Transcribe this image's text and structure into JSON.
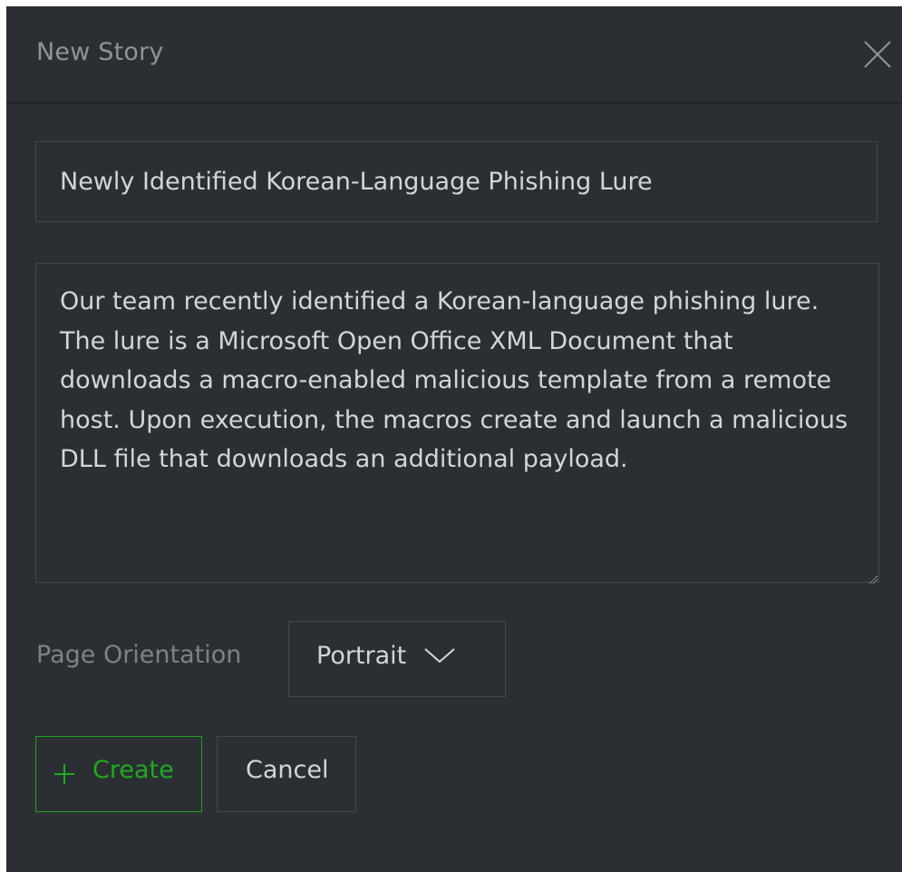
{
  "dialog": {
    "title": "New Story",
    "close_icon": "close-icon"
  },
  "form": {
    "story_title_value": "Newly Identified Korean-Language Phishing Lure",
    "description_value": "Our team recently identified a Korean-language phishing lure. The lure is a Microsoft Open Office XML Document that downloads a macro-enabled malicious template from a remote host. Upon execution, the macros create and launch a malicious DLL file that downloads an additional payload.",
    "orientation_label": "Page Orientation",
    "orientation_selected": "Portrait",
    "orientation_icon": "chevron-down-icon"
  },
  "actions": {
    "create_label": "Create",
    "create_icon": "plus-icon",
    "cancel_label": "Cancel"
  },
  "colors": {
    "background": "#2b2f33",
    "accent": "#1faa1f",
    "border": "#43484e",
    "text": "#d2d6da",
    "muted_text": "#8e949a"
  }
}
